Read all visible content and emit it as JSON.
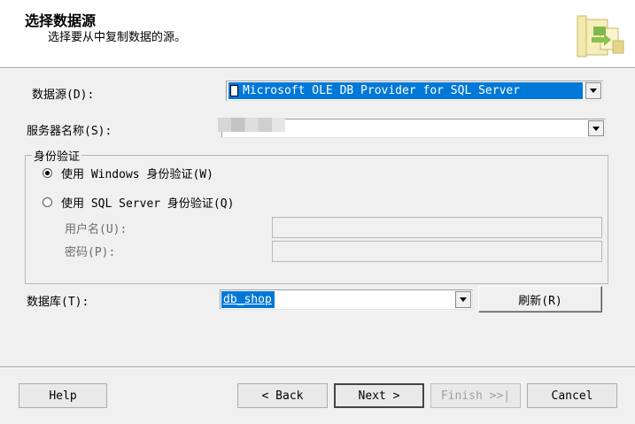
{
  "header": {
    "title": "选择数据源",
    "subtitle": "选择要从中复制数据的源。",
    "icon": "database-wizard-icon"
  },
  "data_source": {
    "label": "数据源(D):",
    "value": "Microsoft OLE DB Provider for SQL Server",
    "icon": "provider-icon"
  },
  "server": {
    "label": "服务器名称(S):",
    "value": ""
  },
  "auth": {
    "group_title": "身份验证",
    "windows_label": "使用 Windows 身份验证(W)",
    "sql_label": "使用 SQL Server 身份验证(Q)",
    "selected": "windows",
    "username_label": "用户名(U):",
    "password_label": "密码(P):",
    "username_value": "",
    "password_value": ""
  },
  "database": {
    "label": "数据库(T):",
    "value": "db_shop",
    "refresh_label": "刷新(R)"
  },
  "footer": {
    "help": "Help",
    "back": "< Back",
    "next": "Next >",
    "finish": "Finish >>|",
    "cancel": "Cancel"
  },
  "colors": {
    "selection": "#0078d7",
    "background": "#f0f0f0"
  }
}
